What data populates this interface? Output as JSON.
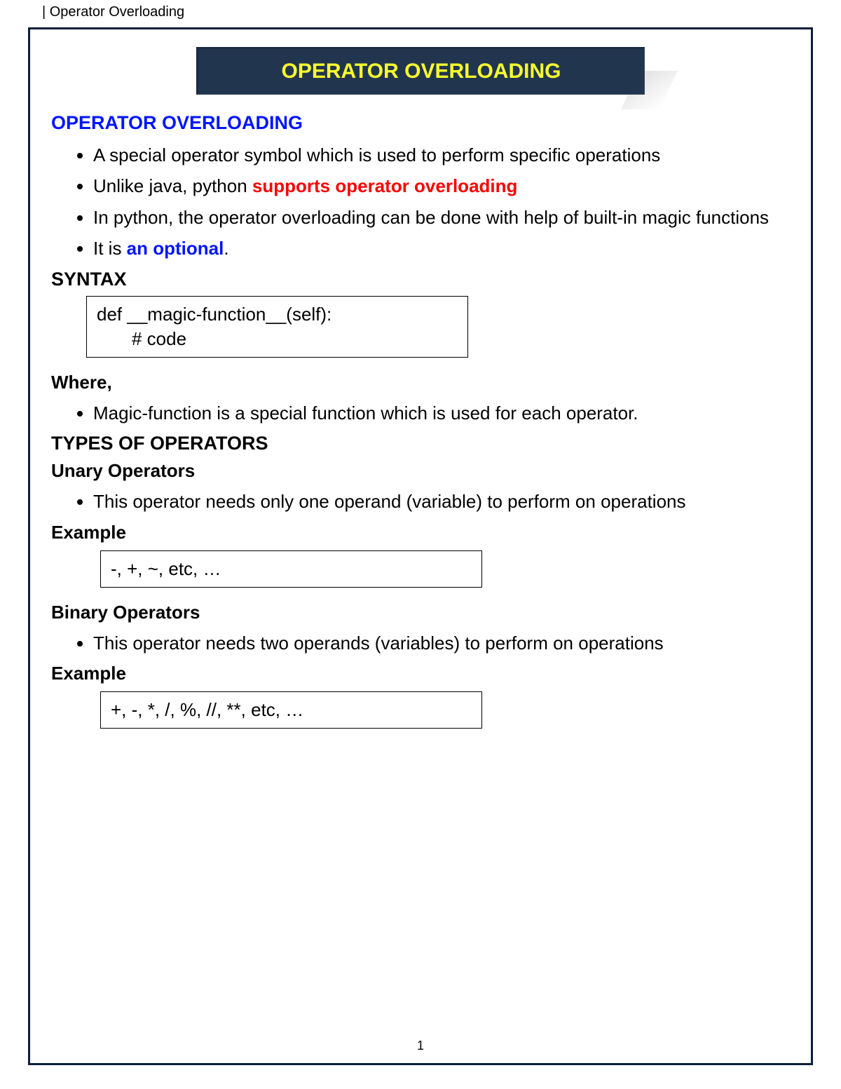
{
  "header": {
    "breadcrumb": "| Operator Overloading"
  },
  "banner": {
    "title": "OPERATOR OVERLOADING"
  },
  "section1": {
    "heading": "OPERATOR OVERLOADING",
    "bullets": {
      "b1": "A special operator symbol which is used to perform specific operations",
      "b2_pre": "Unlike java, python ",
      "b2_em": "supports operator overloading",
      "b3": "In python, the operator overloading can be done with help of built-in magic functions",
      "b4_pre": "It is ",
      "b4_em": "an optional",
      "b4_post": "."
    }
  },
  "syntax": {
    "heading": "SYNTAX",
    "line1": "def __magic-function__(self):",
    "line2": "# code"
  },
  "where": {
    "heading": "Where,",
    "bullet": "Magic-function is a special function which is used for each operator."
  },
  "types": {
    "heading": "TYPES OF OPERATORS"
  },
  "unary": {
    "heading": "Unary Operators",
    "bullet": "This operator needs only one operand (variable) to perform on operations",
    "example_label": "Example",
    "example_text": "-, +, ~, etc, …"
  },
  "binary": {
    "heading": "Binary Operators",
    "bullet": "This operator needs two operands (variables) to perform on operations",
    "example_label": "Example",
    "example_text": "+, -, *, /, %, //, **, etc, …"
  },
  "footer": {
    "page_number": "1"
  }
}
